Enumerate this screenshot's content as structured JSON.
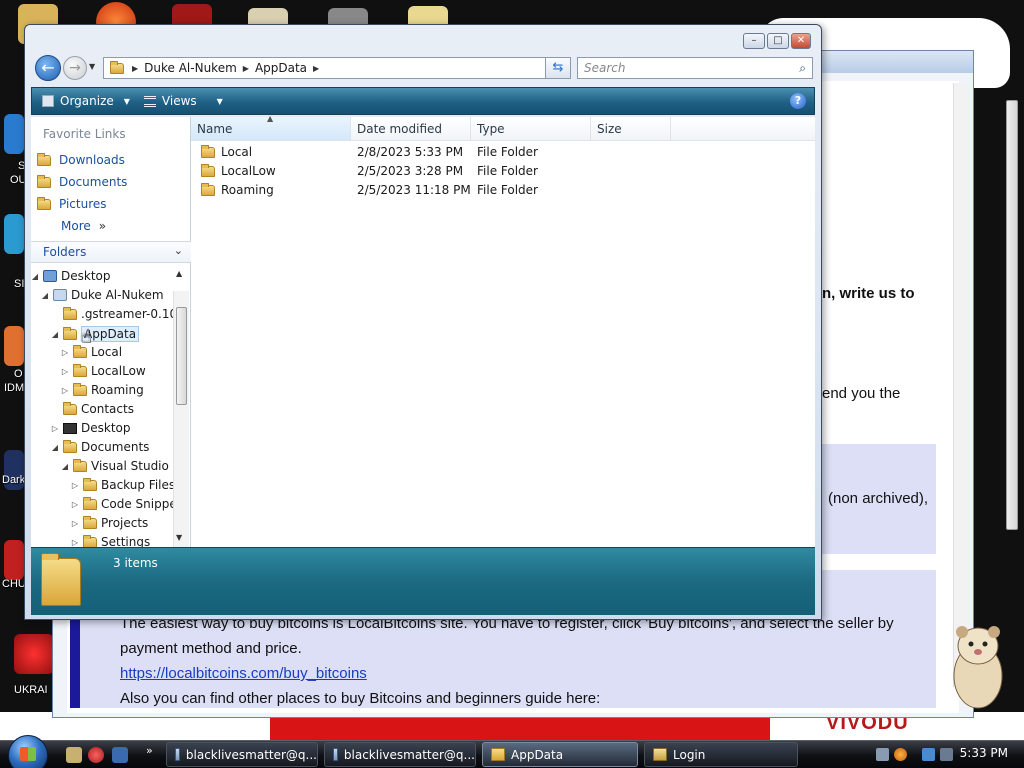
{
  "desktop": {
    "labels": [
      "S",
      "OU",
      "SI",
      "O",
      "IDM",
      "Dark",
      "CHU",
      "UKRAI"
    ]
  },
  "browser": {
    "lines": [
      "n, write us to",
      "end you the",
      "(non archived),",
      "The easiest way to buy bitcoins is LocalBitcoins site. You have to register, click 'Buy bitcoins', and select the seller by",
      "payment method and price.",
      "https://localbitcoins.com/buy_bitcoins",
      "Also you can find other places to buy Bitcoins and beginners guide here:"
    ]
  },
  "wallpaper": {
    "bottom_text": "VIVODU"
  },
  "explorer": {
    "address": [
      "Duke Al-Nukem",
      "AppData"
    ],
    "search_placeholder": "Search",
    "toolbar": {
      "organize": "Organize",
      "views": "Views",
      "help": "?"
    },
    "favorites_header": "Favorite Links",
    "favorites": [
      "Downloads",
      "Documents",
      "Pictures",
      "More"
    ],
    "more_suffix": "»",
    "folders_header": "Folders",
    "tree": [
      "Desktop",
      "Duke Al-Nukem",
      ".gstreamer-0.10",
      "AppData",
      "Local",
      "LocalLow",
      "Roaming",
      "Contacts",
      "Desktop",
      "Documents",
      "Visual Studio 2",
      "Backup Files",
      "Code Snippe",
      "Projects",
      "Settings"
    ],
    "columns": [
      "Name",
      "Date modified",
      "Type",
      "Size"
    ],
    "files": [
      {
        "name": "Local",
        "date": "2/8/2023 5:33 PM",
        "type": "File Folder"
      },
      {
        "name": "LocalLow",
        "date": "2/5/2023 3:28 PM",
        "type": "File Folder"
      },
      {
        "name": "Roaming",
        "date": "2/5/2023 11:18 PM",
        "type": "File Folder"
      }
    ],
    "status": "3 items"
  },
  "taskbar": {
    "tasks": [
      "blacklivesmatter@q...",
      "blacklivesmatter@q...",
      "AppData",
      "Login"
    ],
    "quick_more": "»",
    "clock": "5:33 PM"
  }
}
